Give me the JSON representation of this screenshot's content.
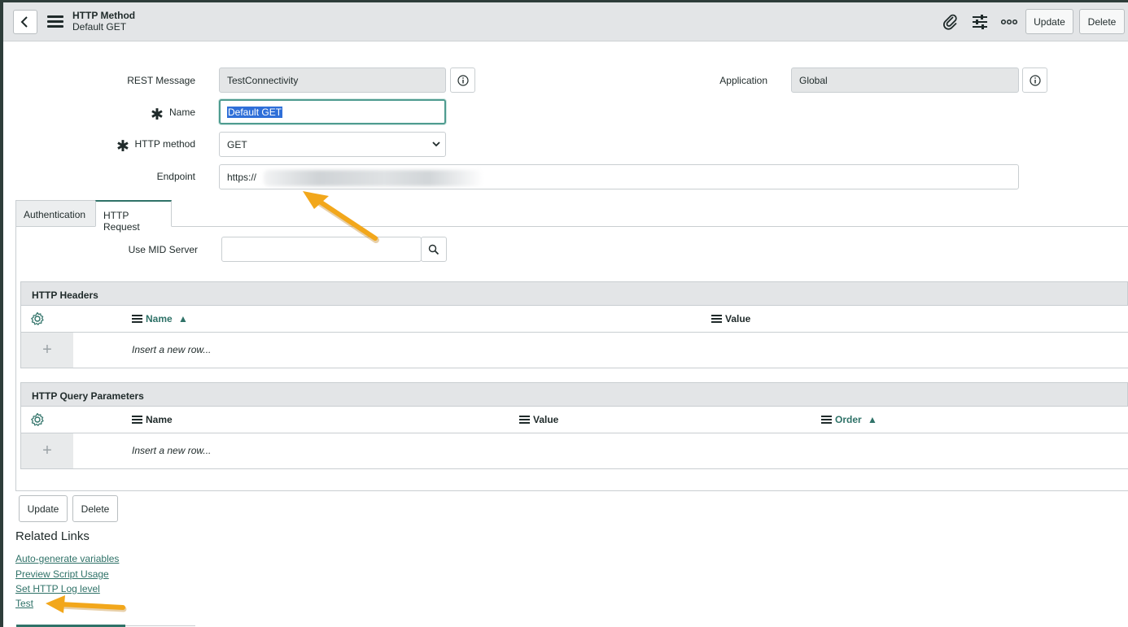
{
  "header": {
    "title": "HTTP Method",
    "subtitle": "Default GET",
    "update_label": "Update",
    "delete_label": "Delete"
  },
  "form": {
    "rest_message_label": "REST Message",
    "rest_message_value": "TestConnectivity",
    "application_label": "Application",
    "application_value": "Global",
    "name_label": "Name",
    "name_value": "Default GET",
    "http_method_label": "HTTP method",
    "http_method_value": "GET",
    "endpoint_label": "Endpoint",
    "endpoint_value": "https://",
    "required_marker": "✱"
  },
  "tabs": [
    {
      "label": "Authentication"
    },
    {
      "label": "HTTP Request"
    }
  ],
  "http_request": {
    "mid_server_label": "Use MID Server",
    "headers_list": {
      "title": "HTTP Headers",
      "columns": [
        "Name",
        "Value"
      ],
      "sort_indicator": "▲",
      "insert_row_text": "Insert a new row..."
    },
    "query_params_list": {
      "title": "HTTP Query Parameters",
      "columns": [
        "Name",
        "Value",
        "Order"
      ],
      "sort_indicator": "▲",
      "insert_row_text": "Insert a new row..."
    }
  },
  "bottom_buttons": {
    "update_label": "Update",
    "delete_label": "Delete"
  },
  "related_links": {
    "title": "Related Links",
    "links": [
      "Auto-generate variables",
      "Preview Script Usage",
      "Set HTTP Log level",
      "Test"
    ]
  },
  "icons": {
    "back": "chevron-left-icon",
    "menu": "hamburger-menu-icon",
    "attachment": "paperclip-icon",
    "personalize": "sliders-icon",
    "more": "more-options-icon",
    "info": "info-icon",
    "search": "search-icon",
    "gear": "gear-icon",
    "plus": "plus-icon",
    "dropdown": "chevron-down-icon",
    "annotation_arrow": "arrow-icon"
  },
  "colors": {
    "accent_teal": "#2f7268",
    "header_bg": "#e3e5e7",
    "annotation_orange": "#f2a71b",
    "selection_blue": "#2f6fd8"
  }
}
